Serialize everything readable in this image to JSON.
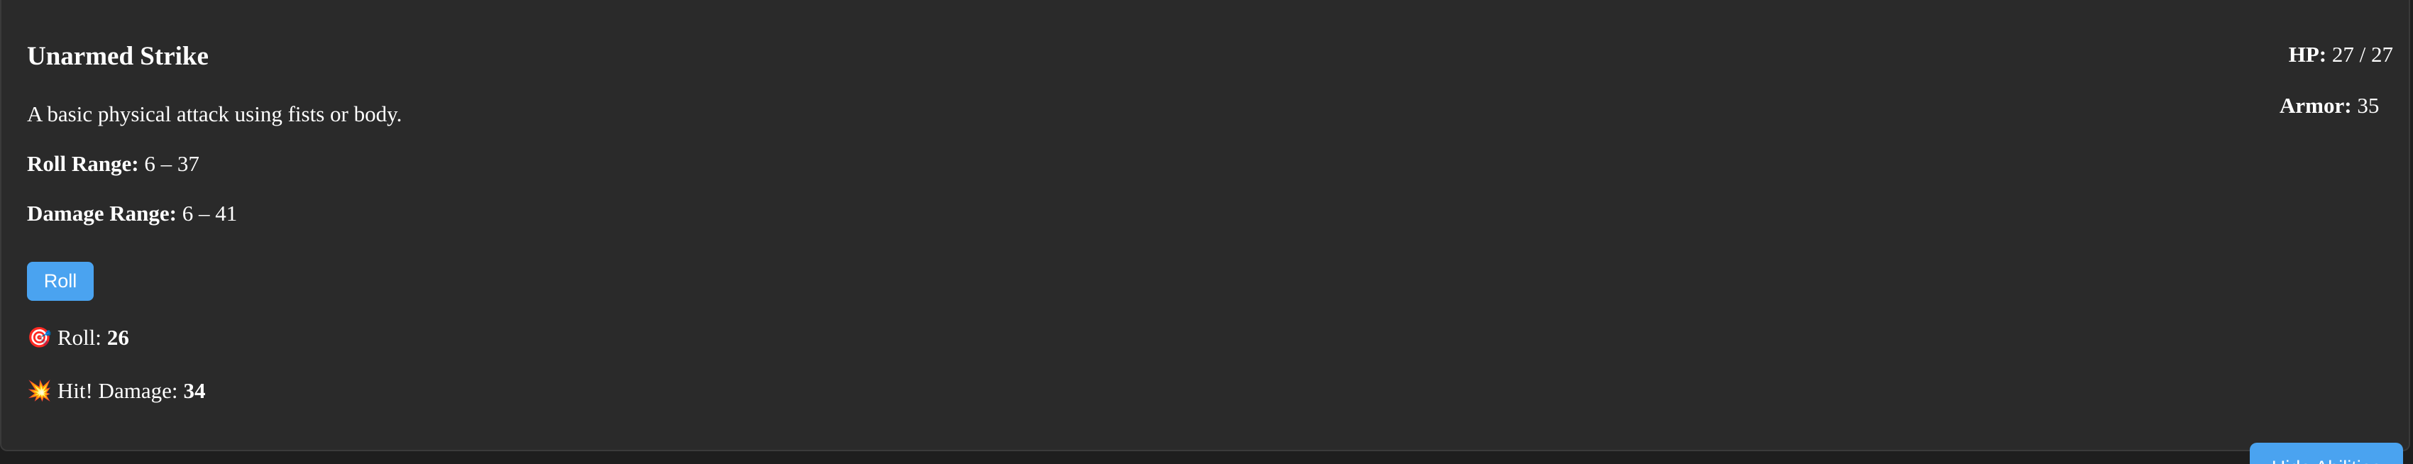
{
  "ability": {
    "name": "Unarmed Strike",
    "description": "A basic physical attack using fists or body.",
    "roll_range_label": "Roll Range:",
    "roll_range_value": " 6 – 37",
    "damage_range_label": "Damage Range:",
    "damage_range_value": " 6 – 41",
    "roll_button_label": "Roll"
  },
  "result": {
    "roll_icon": "🎯",
    "roll_icon_name": "target-icon",
    "roll_label": "Roll:",
    "roll_value": "26",
    "hit_icon": "💥",
    "hit_icon_name": "explosion-icon",
    "hit_label": "Hit! Damage:",
    "hit_value": "34"
  },
  "character": {
    "hp_label": "HP:",
    "hp_value": " 27 / 27",
    "armor_label": "Armor:",
    "armor_value": " 35"
  },
  "footer": {
    "hide_button_label": "Hide Abilities"
  },
  "colors": {
    "background": "#1e1e1e",
    "card": "#2a2a2a",
    "accent": "#4aa3f0",
    "text": "#ffffff"
  }
}
